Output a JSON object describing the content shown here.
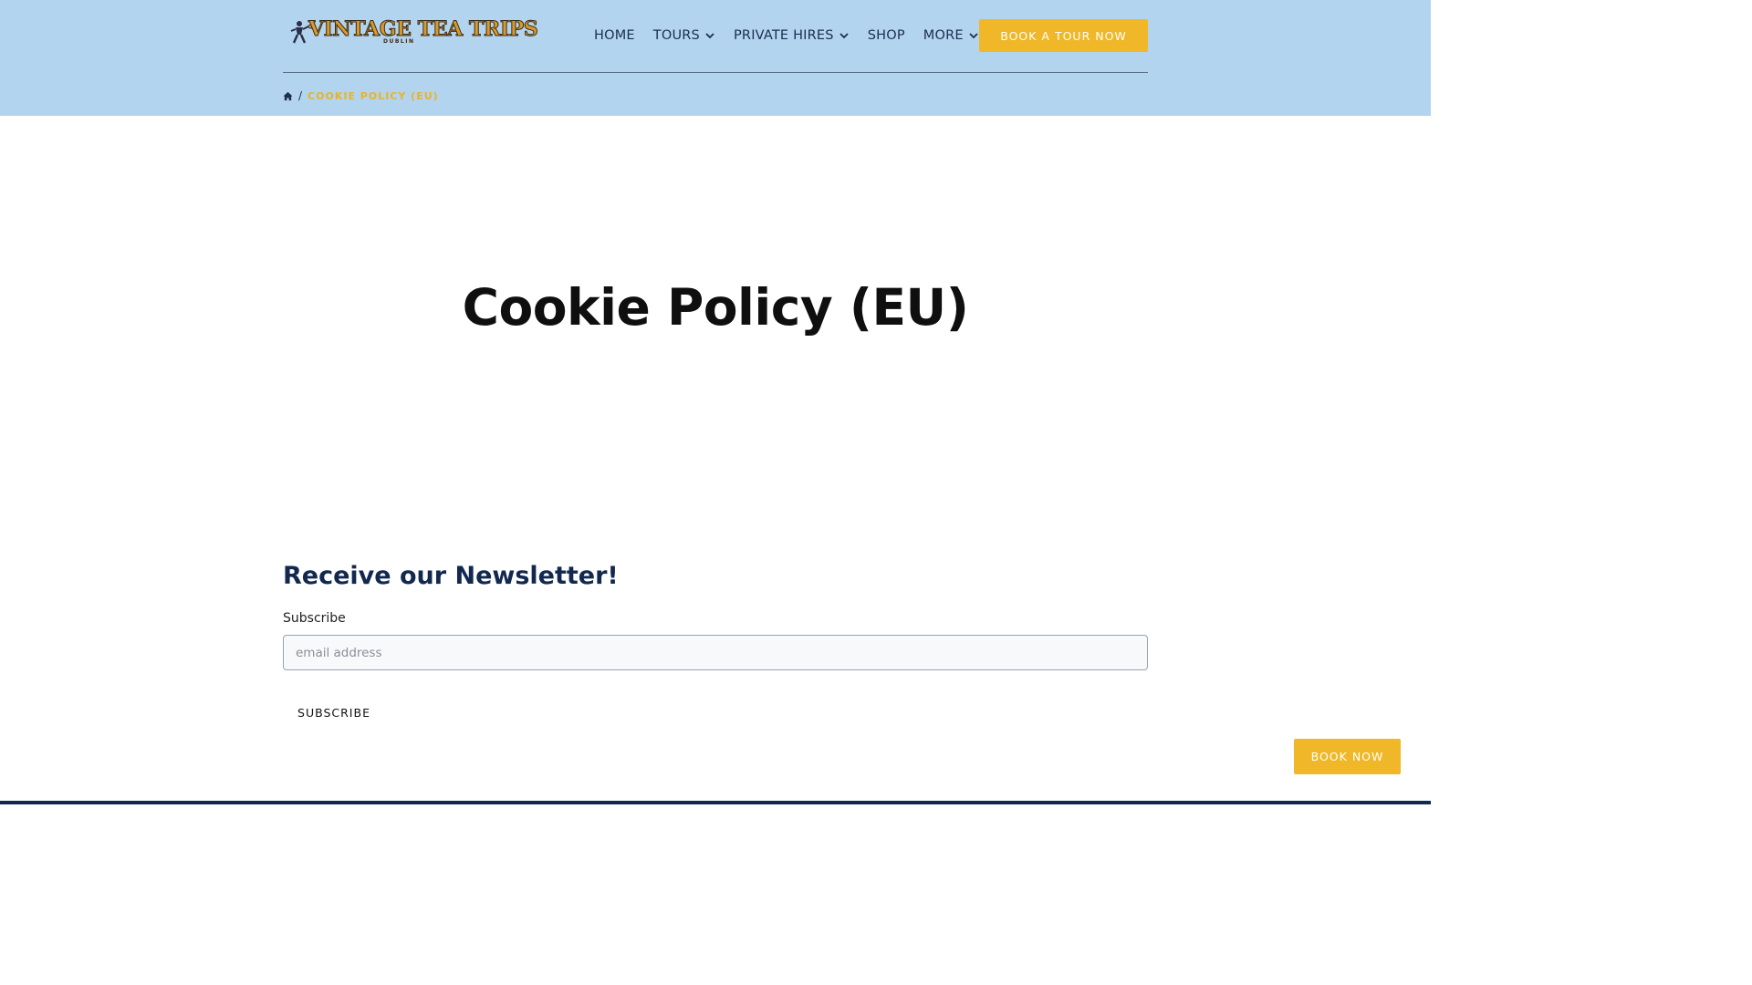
{
  "header": {
    "logo": {
      "name": "VINTAGE TEA TRIPS",
      "sub": "DUBLIN"
    },
    "nav": [
      {
        "label": "HOME",
        "has_dropdown": false
      },
      {
        "label": "TOURS",
        "has_dropdown": true
      },
      {
        "label": "PRIVATE HIRES",
        "has_dropdown": true
      },
      {
        "label": "SHOP",
        "has_dropdown": false
      },
      {
        "label": "MORE",
        "has_dropdown": true
      }
    ],
    "cta_label": "BOOK A TOUR NOW"
  },
  "breadcrumb": {
    "home_icon": "home-icon",
    "separator": "/",
    "current": "COOKIE POLICY (EU)"
  },
  "page": {
    "title": "Cookie Policy (EU)"
  },
  "newsletter": {
    "title": "Receive our Newsletter!",
    "label": "Subscribe",
    "placeholder": "email address",
    "value": "",
    "button_label": "SUBSCRIBE"
  },
  "floating": {
    "book_now_label": "BOOK NOW"
  },
  "colors": {
    "header_bg": "#b3d4ef",
    "accent": "#f0b828",
    "navy": "#12284f",
    "breadcrumb_current": "#e8b32a"
  }
}
